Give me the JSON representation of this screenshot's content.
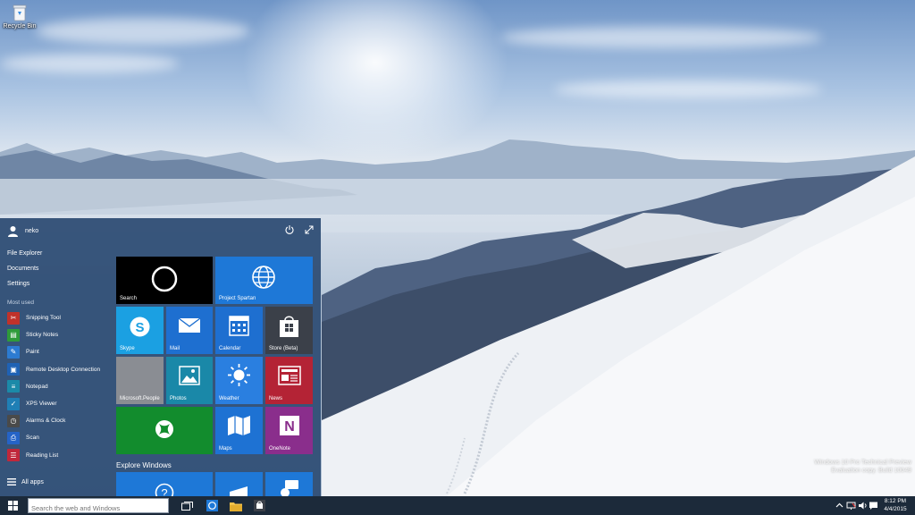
{
  "desktop": {
    "recycle_bin_label": "Recycle Bin",
    "watermark": {
      "line1": "Windows 10 Pro Technical Preview",
      "line2": "Evaluation copy. Build 10049"
    }
  },
  "start_menu": {
    "user_name": "neko",
    "places": [
      "File Explorer",
      "Documents",
      "Settings"
    ],
    "most_used_heading": "Most used",
    "most_used": [
      {
        "label": "Snipping Tool",
        "icon": "scissors-icon",
        "color": "#c0322a"
      },
      {
        "label": "Sticky Notes",
        "icon": "sticky-note-icon",
        "color": "#2e9b3a"
      },
      {
        "label": "Paint",
        "icon": "palette-icon",
        "color": "#2c7bd1"
      },
      {
        "label": "Remote Desktop Connection",
        "icon": "remote-desktop-icon",
        "color": "#1f62b5"
      },
      {
        "label": "Notepad",
        "icon": "notepad-icon",
        "color": "#1b8aa8"
      },
      {
        "label": "XPS Viewer",
        "icon": "xps-icon",
        "color": "#1f7fb5"
      },
      {
        "label": "Alarms & Clock",
        "icon": "clock-icon",
        "color": "#4a4a4a"
      },
      {
        "label": "Scan",
        "icon": "scan-icon",
        "color": "#2563c7"
      },
      {
        "label": "Reading List",
        "icon": "reading-list-icon",
        "color": "#c0283b"
      }
    ],
    "all_apps_label": "All apps",
    "tiles": [
      {
        "label": "Search",
        "icon": "cortana-circle-icon",
        "color": "#000000"
      },
      {
        "label": "Project Spartan",
        "icon": "globe-icon",
        "color": "#1e78d7"
      },
      {
        "label": "Skype",
        "icon": "skype-icon",
        "color": "#1ba0e2"
      },
      {
        "label": "Mail",
        "icon": "mail-icon",
        "color": "#1e6fd0"
      },
      {
        "label": "Calendar",
        "icon": "calendar-icon",
        "color": "#1e6fd0"
      },
      {
        "label": "Store (Beta)",
        "icon": "store-bag-icon",
        "color": "#3b4049"
      },
      {
        "label": "Microsoft.People",
        "icon": "",
        "color": "#8a8d93"
      },
      {
        "label": "Photos",
        "icon": "photo-icon",
        "color": "#1a88a8"
      },
      {
        "label": "Weather",
        "icon": "sun-icon",
        "color": "#2a7fe0"
      },
      {
        "label": "News",
        "icon": "news-icon",
        "color": "#b42335"
      },
      {
        "label": "",
        "icon": "xbox-icon",
        "color": "#128c2d"
      },
      {
        "label": "Maps",
        "icon": "map-icon",
        "color": "#1e72d3"
      },
      {
        "label": "OneNote",
        "icon": "onenote-icon",
        "color": "#8a2e8c"
      }
    ],
    "explore_heading": "Explore Windows",
    "explore_tiles": [
      {
        "icon": "help-icon",
        "color": "#1e78d7"
      },
      {
        "icon": "tablet-icon",
        "color": "#1e78d7"
      },
      {
        "icon": "people-chat-icon",
        "color": "#1e78d7"
      }
    ]
  },
  "taskbar": {
    "search_placeholder": "Search the web and Windows",
    "pinned": [
      {
        "icon": "task-view-icon"
      },
      {
        "icon": "spartan-browser-icon"
      },
      {
        "icon": "file-explorer-icon"
      },
      {
        "icon": "store-icon"
      }
    ],
    "tray_icons": [
      "chevron-up-icon",
      "network-icon",
      "volume-icon",
      "notification-icon"
    ],
    "clock": {
      "time": "8:12 PM",
      "date": "4/4/2015"
    }
  }
}
